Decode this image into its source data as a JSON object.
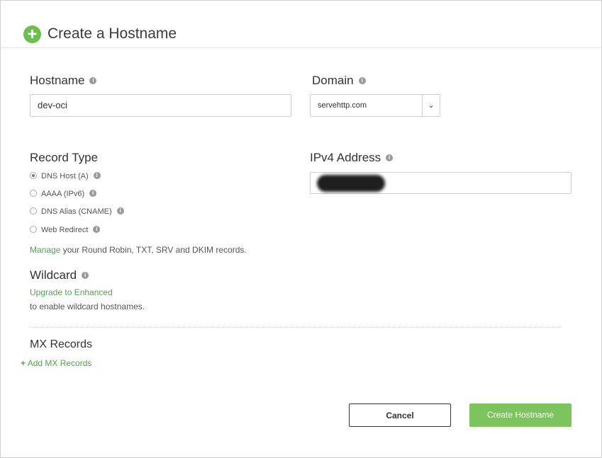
{
  "header": {
    "title": "Create a Hostname",
    "icon": "plus-circle-icon"
  },
  "hostname": {
    "label": "Hostname",
    "value": "dev-oci"
  },
  "domain": {
    "label": "Domain",
    "value": "servehttp.com"
  },
  "record_type": {
    "label": "Record Type",
    "options": [
      {
        "label": "DNS Host (A)",
        "checked": true
      },
      {
        "label": "AAAA (IPv6)",
        "checked": false
      },
      {
        "label": "DNS Alias (CNAME)",
        "checked": false
      },
      {
        "label": "Web Redirect",
        "checked": false
      }
    ],
    "manage_link": "Manage",
    "manage_text": " your Round Robin, TXT, SRV and DKIM records."
  },
  "ipv4": {
    "label": "IPv4 Address",
    "value": ""
  },
  "wildcard": {
    "label": "Wildcard",
    "upgrade_link": "Upgrade to Enhanced",
    "upgrade_text": "to enable wildcard hostnames."
  },
  "mx": {
    "label": "MX Records",
    "add_link": "Add MX Records"
  },
  "buttons": {
    "cancel": "Cancel",
    "create": "Create Hostname"
  },
  "colors": {
    "accent": "#7dc35e",
    "link": "#5a9e5a"
  }
}
